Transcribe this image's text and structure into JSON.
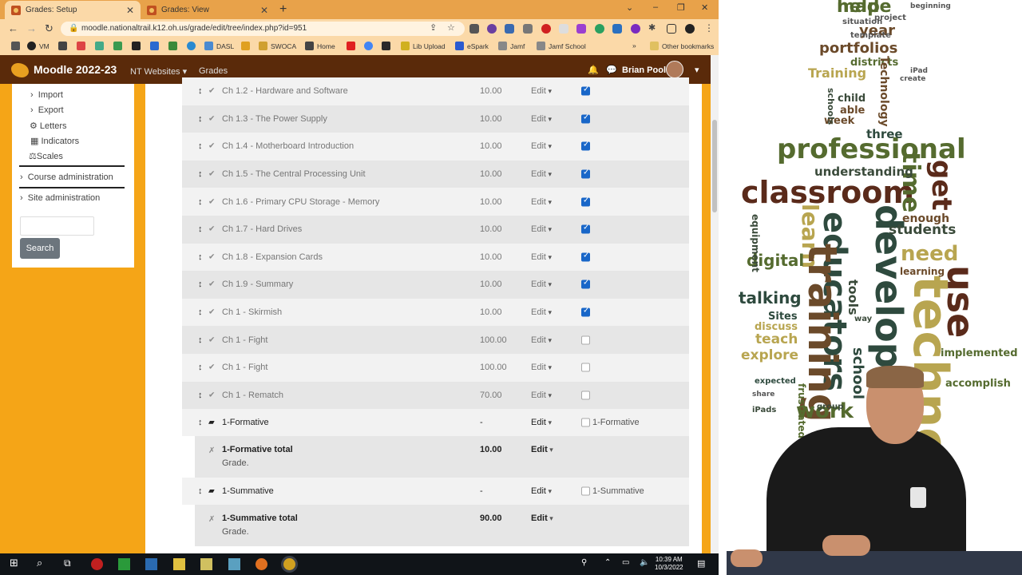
{
  "browser": {
    "tabs": [
      {
        "label": "Grades: Setup",
        "active": true
      },
      {
        "label": "Grades: View",
        "active": false
      }
    ],
    "url": "moodle.nationaltrail.k12.oh.us/grade/edit/tree/index.php?id=951",
    "bookmarks": [
      "VM",
      "DASL",
      "SWOCA",
      "Home",
      "Lib Upload",
      "eSpark",
      "Jamf",
      "Jamf School"
    ],
    "bookmarks_overflow": "»",
    "other_bookmarks": "Other bookmarks"
  },
  "moodle": {
    "site_name": "Moodle 2022-23",
    "nav": [
      "NT Websites",
      "Grades"
    ],
    "user_name": "Brian Pool"
  },
  "sidebar": {
    "items": [
      "Import",
      "Export",
      "Letters",
      "Indicators",
      "Scales"
    ],
    "sections": [
      "Course administration",
      "Site administration"
    ],
    "search_button": "Search"
  },
  "grade_rows": [
    {
      "name": "Ch 1.2 - Hardware and Software",
      "value": "10.00",
      "edit": "Edit",
      "checked": true
    },
    {
      "name": "Ch 1.3 - The Power Supply",
      "value": "10.00",
      "edit": "Edit",
      "checked": true
    },
    {
      "name": "Ch 1.4 - Motherboard Introduction",
      "value": "10.00",
      "edit": "Edit",
      "checked": true
    },
    {
      "name": "Ch 1.5 - The Central Processing Unit",
      "value": "10.00",
      "edit": "Edit",
      "checked": true
    },
    {
      "name": "Ch 1.6 - Primary CPU Storage - Memory",
      "value": "10.00",
      "edit": "Edit",
      "checked": true
    },
    {
      "name": "Ch 1.7 - Hard Drives",
      "value": "10.00",
      "edit": "Edit",
      "checked": true
    },
    {
      "name": "Ch 1.8 - Expansion Cards",
      "value": "10.00",
      "edit": "Edit",
      "checked": true
    },
    {
      "name": "Ch 1.9 - Summary",
      "value": "10.00",
      "edit": "Edit",
      "checked": true
    },
    {
      "name": "Ch 1 - Skirmish",
      "value": "10.00",
      "edit": "Edit",
      "checked": true
    },
    {
      "name": "Ch 1 - Fight",
      "value": "100.00",
      "edit": "Edit",
      "checked": false
    },
    {
      "name": "Ch 1 - Fight",
      "value": "100.00",
      "edit": "Edit",
      "checked": false
    },
    {
      "name": "Ch 1 - Rematch",
      "value": "70.00",
      "edit": "Edit",
      "checked": false
    }
  ],
  "categories": [
    {
      "name": "1-Formative",
      "value": "-",
      "edit": "Edit",
      "check_label": "1-Formative",
      "total_name": "1-Formative total",
      "total_sub": "Grade.",
      "total_value": "10.00",
      "total_edit": "Edit"
    },
    {
      "name": "1-Summative",
      "value": "-",
      "edit": "Edit",
      "check_label": "1-Summative",
      "total_name": "1-Summative total",
      "total_sub": "Grade.",
      "total_value": "90.00",
      "total_edit": "Edit"
    }
  ],
  "taskbar": {
    "time": "10:39 AM",
    "date": "10/3/2022"
  },
  "word_cloud": [
    "help",
    "year",
    "portfolios",
    "Training",
    "districts",
    "Technology",
    "professional",
    "classroom",
    "time",
    "get",
    "understanding",
    "educators",
    "develop",
    "need",
    "students",
    "learn",
    "training",
    "use",
    "techno",
    "digital",
    "talking",
    "learning",
    "Sites",
    "discuss",
    "teach",
    "explore",
    "school",
    "work",
    "implemented",
    "accomplish",
    "expected",
    "frustrated",
    "able",
    "week",
    "child",
    "three",
    "schools",
    "create",
    "equipment",
    "tools",
    "enough",
    "way",
    "iPad",
    "iPads",
    "group",
    "share",
    "beginning",
    "situation",
    "project",
    "template",
    "made"
  ]
}
